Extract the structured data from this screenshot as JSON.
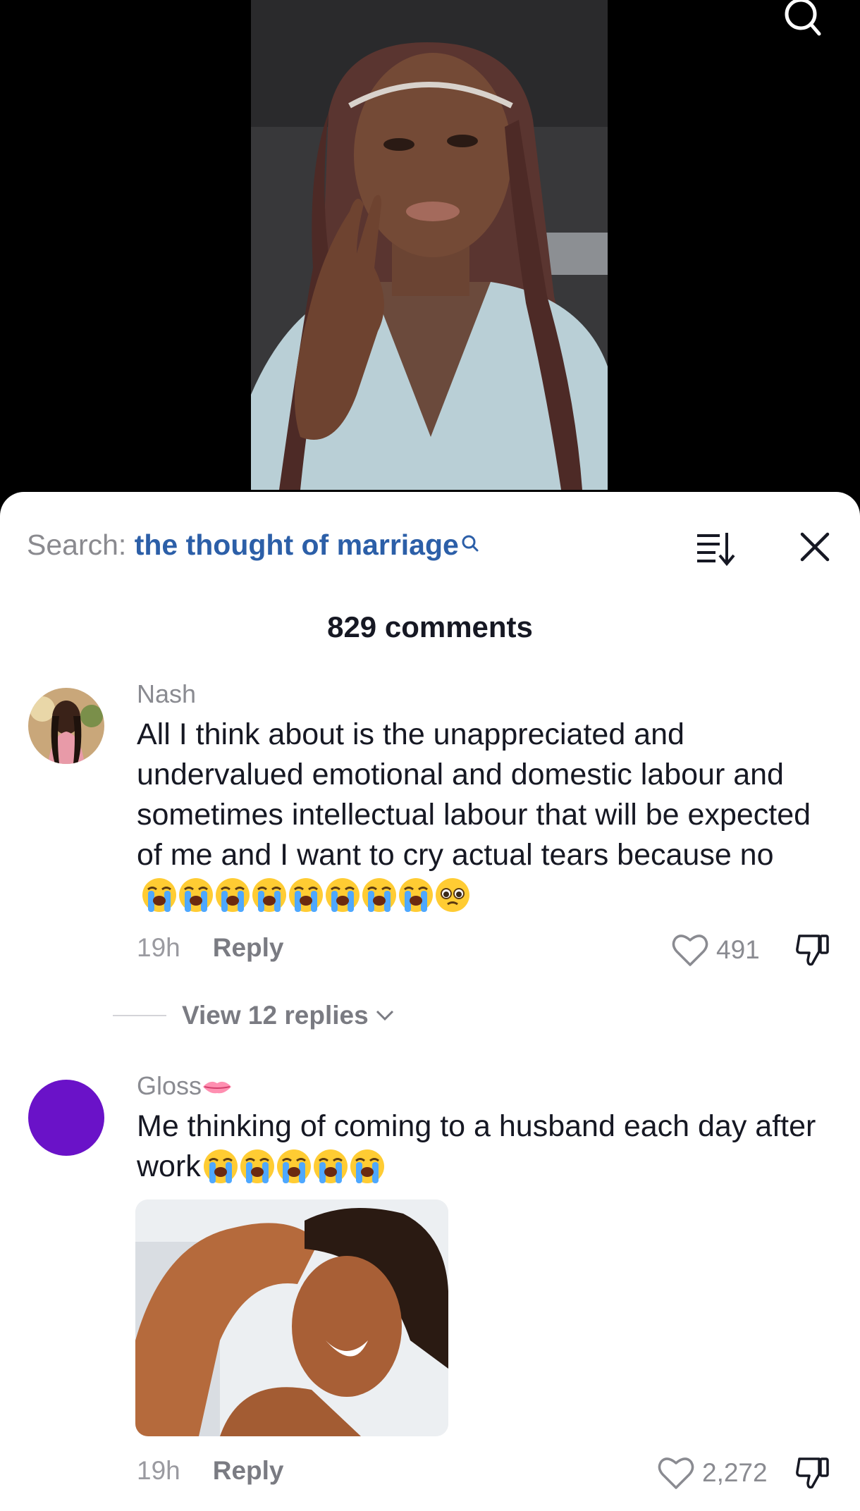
{
  "video": {
    "search_icon": "search-icon"
  },
  "comments_sheet": {
    "search_prefix": "Search: ",
    "search_query": "the thought of marriage",
    "sort_icon": "sort-icon",
    "close_icon": "close-icon",
    "title": "829 comments"
  },
  "comments": [
    {
      "username": "Nash",
      "text": "All I think about is the unappreciated and undervalued emotional and domestic labour and sometimes intellectual labour that will be expected of me and I want to cry actual tears because no",
      "emojis": [
        "loudly-crying-face",
        "loudly-crying-face",
        "loudly-crying-face",
        "loudly-crying-face",
        "loudly-crying-face",
        "loudly-crying-face",
        "loudly-crying-face",
        "loudly-crying-face",
        "face-holding-back-tears"
      ],
      "time": "19h",
      "reply_label": "Reply",
      "likes": "491",
      "view_replies": "View 12 replies"
    },
    {
      "username": "Gloss",
      "username_emoji": "lips-icon",
      "avatar_color": "#6a12c8",
      "text": "Me thinking of coming to a husband each day after work",
      "emojis": [
        "loudly-crying-face",
        "loudly-crying-face",
        "loudly-crying-face",
        "loudly-crying-face",
        "loudly-crying-face"
      ],
      "time": "19h",
      "reply_label": "Reply",
      "likes": "2,272"
    }
  ],
  "colors": {
    "search_query": "#2c5fa8",
    "muted_text": "#8a8b91",
    "body_text": "#161823"
  }
}
